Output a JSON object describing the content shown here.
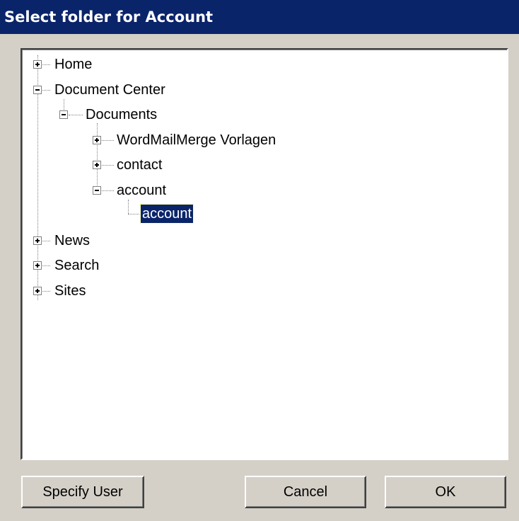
{
  "dialog": {
    "title": "Select folder for Account"
  },
  "tree": {
    "nodes": [
      {
        "label": "Home",
        "state": "collapsed"
      },
      {
        "label": "Document Center",
        "state": "expanded"
      },
      {
        "label": "Documents",
        "state": "expanded"
      },
      {
        "label": "WordMailMerge Vorlagen",
        "state": "collapsed"
      },
      {
        "label": "contact",
        "state": "collapsed"
      },
      {
        "label": "account",
        "state": "expanded"
      },
      {
        "label": "account",
        "state": "leaf",
        "selected": true
      },
      {
        "label": "News",
        "state": "collapsed"
      },
      {
        "label": "Search",
        "state": "collapsed"
      },
      {
        "label": "Sites",
        "state": "collapsed"
      }
    ]
  },
  "buttons": {
    "specify_user": "Specify User",
    "cancel": "Cancel",
    "ok": "OK"
  },
  "colors": {
    "title_bar": "#0a246a",
    "dialog_face": "#d4d0c8",
    "selection": "#0a246a"
  }
}
